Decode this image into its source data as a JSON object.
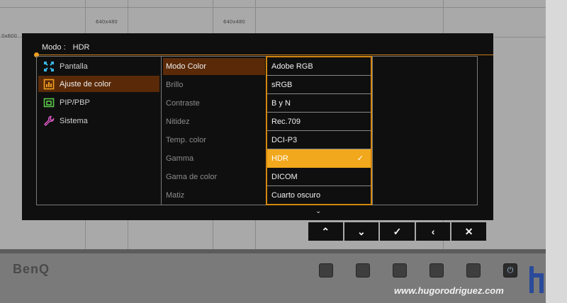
{
  "screen_labels": [
    "640x480",
    "640x480",
    "0x600"
  ],
  "osd": {
    "mode_label": "Modo :",
    "mode_value": "HDR",
    "categories": [
      {
        "label": "Pantalla",
        "icon": "display-settings-icon",
        "color": "#39b7e8"
      },
      {
        "label": "Ajuste de color",
        "icon": "color-adjust-icon",
        "color": "#f0a020"
      },
      {
        "label": "PIP/PBP",
        "icon": "pip-icon",
        "color": "#5cc84a"
      },
      {
        "label": "Sistema",
        "icon": "wrench-icon",
        "color": "#e05ac8"
      }
    ],
    "options": [
      "Modo Color",
      "Brillo",
      "Contraste",
      "Nitidez",
      "Temp. color",
      "Gamma",
      "Gama de color",
      "Matiz"
    ],
    "values": [
      "Adobe RGB",
      "sRGB",
      "B y N",
      "Rec.709",
      "DCI-P3",
      "HDR",
      "DICOM",
      "Cuarto oscuro"
    ],
    "selected_value": "HDR",
    "check_mark": "✓",
    "more_indicator": "⌄"
  },
  "nav_buttons": [
    {
      "name": "up",
      "glyph": "⌃"
    },
    {
      "name": "down",
      "glyph": "⌄"
    },
    {
      "name": "confirm",
      "glyph": "✓"
    },
    {
      "name": "back",
      "glyph": "‹"
    },
    {
      "name": "close",
      "glyph": "✕"
    }
  ],
  "brand": "BenQ",
  "power_glyph": "⏻",
  "watermark": "www.hugorodriguez.com",
  "colors": {
    "accent": "#f2a81d",
    "active_bg": "#5a2a08"
  }
}
